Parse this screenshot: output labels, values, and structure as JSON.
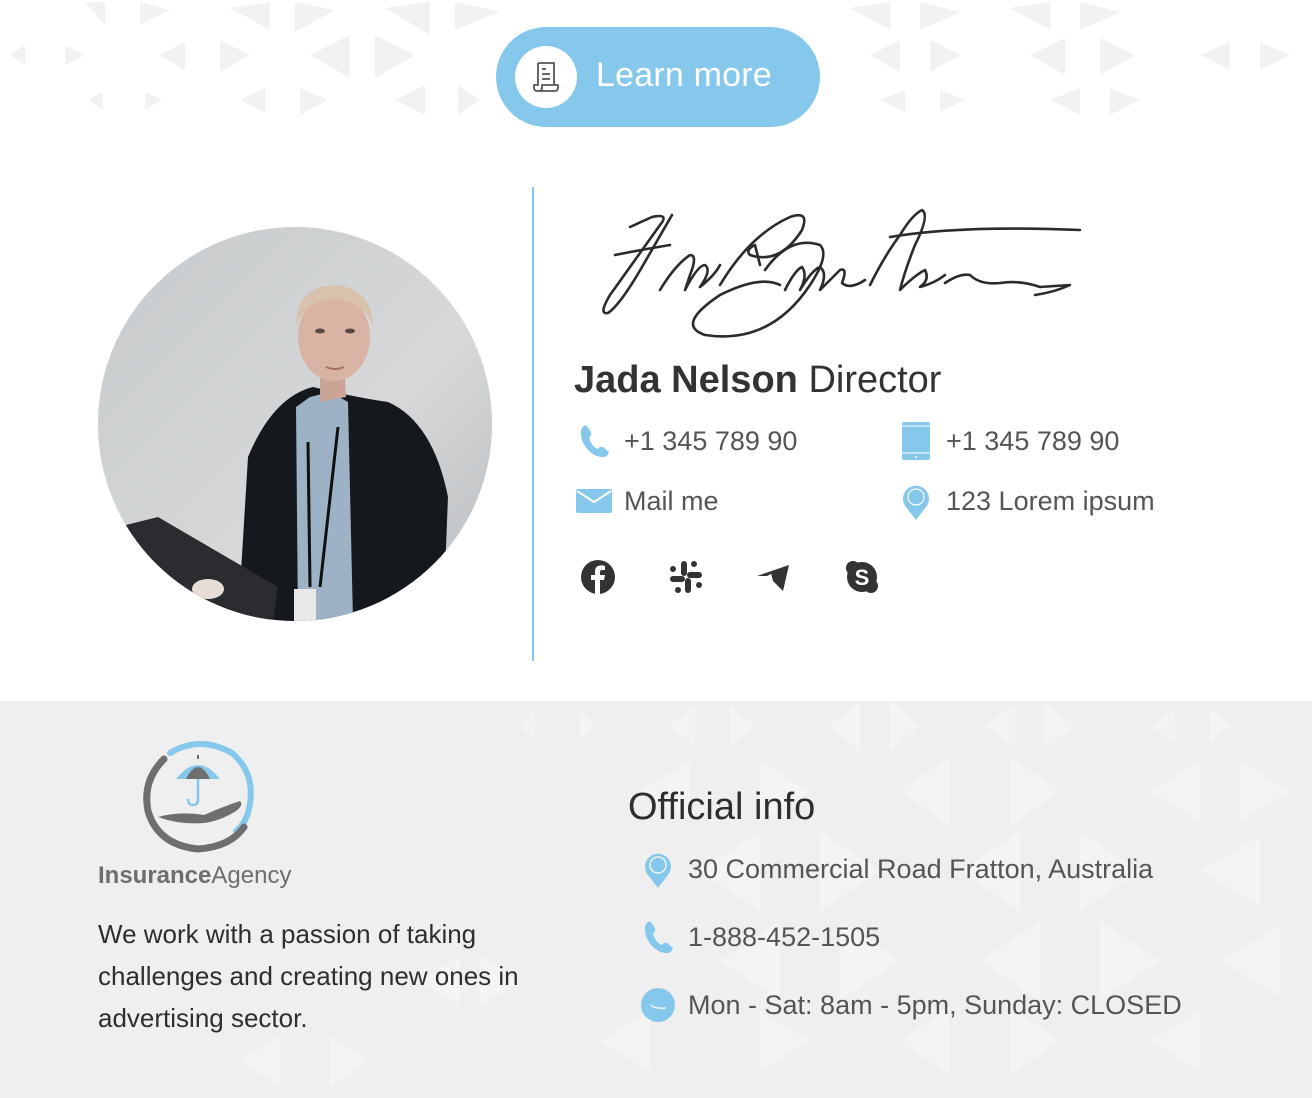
{
  "colors": {
    "accent": "#86c8ec",
    "text_dark": "#333333",
    "text_muted": "#555555",
    "footer_bg": "#efefef",
    "social_icon": "#333333"
  },
  "cta": {
    "label": "Learn more",
    "icon": "document-scroll-icon"
  },
  "profile": {
    "photo_alt": "Portrait of Jada Nelson",
    "signature_alt": "Handwritten signature",
    "name": "Jada Nelson",
    "title": "Director"
  },
  "contacts": [
    {
      "icon": "phone-icon",
      "value": "+1 345 789 90"
    },
    {
      "icon": "tablet-icon",
      "value": "+1 345 789 90"
    },
    {
      "icon": "mail-icon",
      "value": "Mail me"
    },
    {
      "icon": "location-pin-icon",
      "value": "123 Lorem ipsum"
    }
  ],
  "social": [
    {
      "icon": "facebook-icon",
      "label": "Facebook"
    },
    {
      "icon": "slack-icon",
      "label": "Slack"
    },
    {
      "icon": "telegram-icon",
      "label": "Telegram"
    },
    {
      "icon": "skype-icon",
      "label": "Skype"
    }
  ],
  "company": {
    "logo_bold": "Insurance",
    "logo_regular": "Agency",
    "description": "We work with a passion of taking challenges and creating new ones in advertising sector."
  },
  "official": {
    "title": "Official info",
    "rows": [
      {
        "icon": "location-pin-icon",
        "value": "30 Commercial Road Fratton, Australia"
      },
      {
        "icon": "phone-icon",
        "value": "1-888-452-1505"
      },
      {
        "icon": "clock-icon",
        "value": "Mon - Sat: 8am - 5pm, Sunday: CLOSED"
      }
    ]
  }
}
